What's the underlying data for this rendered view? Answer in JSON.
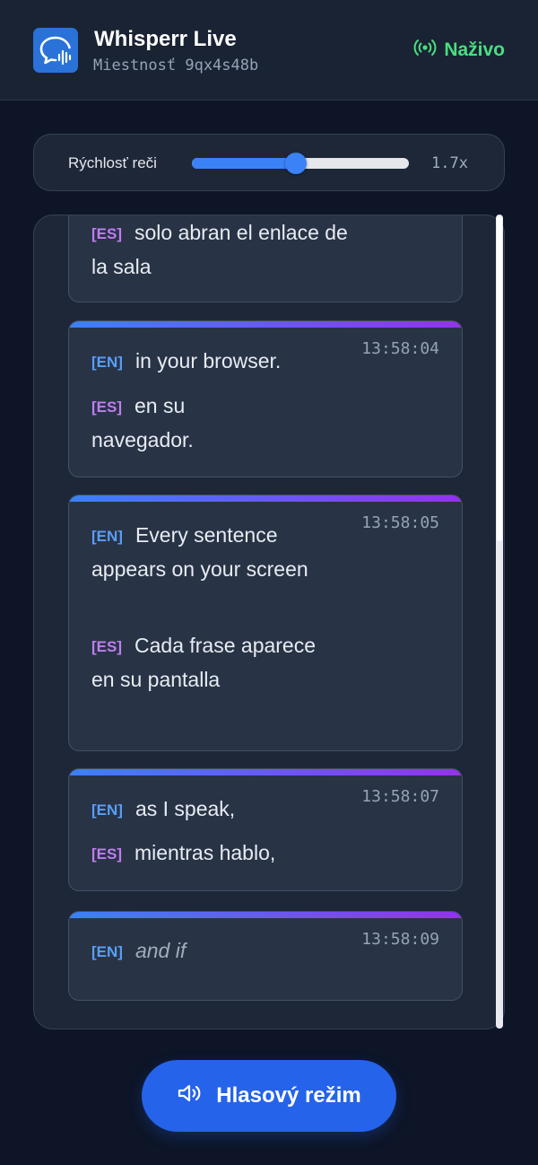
{
  "header": {
    "app_title": "Whisperr Live",
    "room_id": "Miestnosť 9qx4s48b",
    "live_label": "Naživo",
    "live_icon": "broadcast-icon",
    "logo_icon": "chat-waveform-icon"
  },
  "speed": {
    "label": "Rýchlosť reči",
    "value_label": "1.7x",
    "fraction": 0.48
  },
  "segments": [
    {
      "time": "",
      "en": "",
      "es": "solo abran el enlace de la sala"
    },
    {
      "time": "13:58:04",
      "en": "in your browser.",
      "es": "en su navegador."
    },
    {
      "time": "13:58:05",
      "en": "Every sentence appears on your screen",
      "es": "Cada frase aparece en su pantalla"
    },
    {
      "time": "13:58:07",
      "en": "as I speak,",
      "es": "mientras hablo,"
    },
    {
      "time": "13:58:09",
      "en": "and if",
      "es": ""
    }
  ],
  "lang_tags": {
    "en": "[EN]",
    "es": "[ES]"
  },
  "voice_button": {
    "label": "Hlasový režim",
    "icon": "speaker-icon"
  },
  "colors": {
    "accent": "#2563eb",
    "live": "#4ade80",
    "tag_en": "#5b9ef5",
    "tag_es": "#c07ef0"
  }
}
